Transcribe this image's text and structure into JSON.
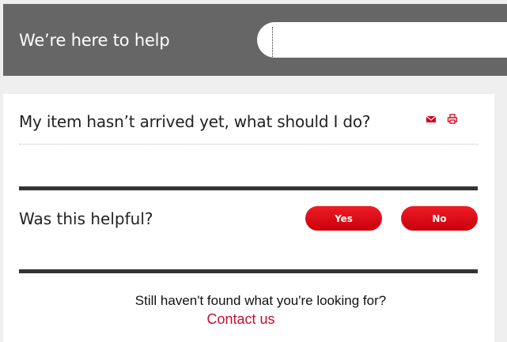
{
  "header": {
    "title": "We’re here to help",
    "search_value": ""
  },
  "article": {
    "question": "My item hasn’t arrived yet, what should I do?",
    "email_icon": "envelope-icon",
    "print_icon": "printer-icon"
  },
  "feedback": {
    "label": "Was this helpful?",
    "yes_label": "Yes",
    "no_label": "No"
  },
  "footer": {
    "text": "Still haven't found what you're looking for?",
    "link_label": "Contact us"
  },
  "colors": {
    "header_bg": "#666666",
    "accent_red": "#e30613",
    "link_red": "#c8102e",
    "rule": "#333333"
  }
}
